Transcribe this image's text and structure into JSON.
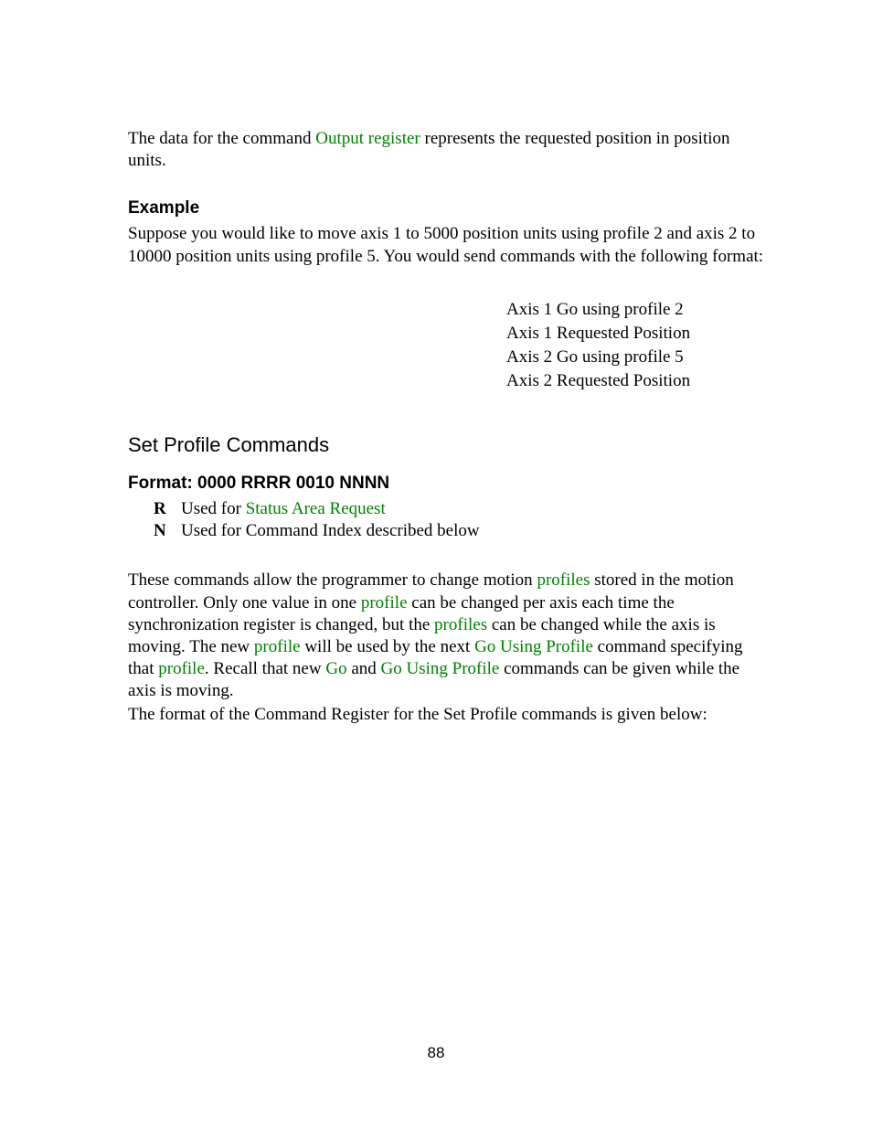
{
  "intro": {
    "pre": "The data for the command ",
    "link": "Output register",
    "post": " represents the requested position in position units."
  },
  "example": {
    "heading": "Example",
    "body": "Suppose you would like to move axis 1 to 5000 position units using profile 2 and axis 2 to 10000 position units using profile 5.  You would send commands with the following format:",
    "lines": [
      "Axis 1 Go using profile 2",
      "Axis 1 Requested Position",
      "Axis 2 Go using profile 5",
      "Axis 2 Requested Position"
    ]
  },
  "section": {
    "heading": "Set Profile Commands",
    "format_heading": "Format: 0000 RRRR 0010 NNNN",
    "defs": [
      {
        "letter": "R",
        "pre": "Used for ",
        "link": "Status Area Request",
        "post": ""
      },
      {
        "letter": "N",
        "pre": "Used for Command Index described below",
        "link": "",
        "post": ""
      }
    ]
  },
  "body": {
    "p1": {
      "t0": "These commands allow the programmer to change motion ",
      "l0": "profiles",
      "t1": " stored in the motion controller.  Only one value in one ",
      "l1": "profile",
      "t2": " can be changed per axis each time the synchronization register is changed, but the ",
      "l2": "profiles",
      "t3": " can be changed while the axis is moving.  The new ",
      "l3": "profile",
      "t4": " will be used by the next ",
      "l4": "Go Using Profile",
      "t5": " command specifying that ",
      "l5": "profile",
      "t6": ".  Recall that new ",
      "l6": "Go",
      "t7": " and ",
      "l7": "Go Using Profile",
      "t8": " commands can be given while the axis is moving."
    },
    "p2": "The format of the Command Register for the Set Profile commands is given below:"
  },
  "page_number": "88"
}
